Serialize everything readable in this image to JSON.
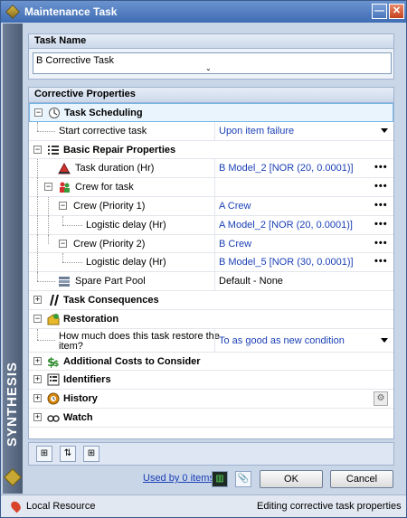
{
  "window": {
    "title": "Maintenance Task",
    "minimize_glyph": "—",
    "close_glyph": "✕"
  },
  "brand": "SYNTHESIS",
  "task_name": {
    "header": "Task Name",
    "value": "B Corrective Task"
  },
  "properties": {
    "header": "Corrective Properties",
    "rows": {
      "task_scheduling": "Task Scheduling",
      "start_corrective_task": {
        "label": "Start corrective task",
        "value": "Upon item failure"
      },
      "basic_repair_properties": "Basic Repair Properties",
      "task_duration": {
        "label": "Task duration (Hr)",
        "value": "B Model_2 [NOR (20, 0.0001)]"
      },
      "crew_for_task": "Crew for task",
      "crew_priority_1": {
        "label": "Crew (Priority 1)",
        "value": "A Crew"
      },
      "logistic_delay_1": {
        "label": "Logistic delay (Hr)",
        "value": "A Model_2 [NOR (20, 0.0001)]"
      },
      "crew_priority_2": {
        "label": "Crew (Priority 2)",
        "value": "B Crew"
      },
      "logistic_delay_2": {
        "label": "Logistic delay (Hr)",
        "value": "B Model_5 [NOR (30, 0.0001)]"
      },
      "spare_part_pool": {
        "label": "Spare Part Pool",
        "value": "Default - None"
      },
      "task_consequences": "Task Consequences",
      "restoration": "Restoration",
      "restore_question": {
        "label_line1": "How much does this task restore the",
        "label_line2": "item?",
        "value": "To as good as new condition"
      },
      "additional_costs": "Additional Costs to Consider",
      "identifiers": "Identifiers",
      "history": "History",
      "watch": "Watch"
    },
    "ellipsis": "•••",
    "expand_minus": "−",
    "expand_plus": "+"
  },
  "actions": {
    "used_by": "Used by 0 items",
    "ok": "OK",
    "cancel": "Cancel"
  },
  "status": {
    "resource": "Local Resource",
    "message": "Editing corrective task properties"
  },
  "icons": [
    "scheduling-icon",
    "repair-properties-icon",
    "duration-icon",
    "crew-icon",
    "spare-part-icon",
    "consequences-icon",
    "restoration-icon",
    "costs-icon",
    "identifiers-icon",
    "history-icon",
    "watch-icon"
  ],
  "colors": {
    "link": "#1a3fb5",
    "titlebar": "#3f6db3",
    "selection": "#76b6e6"
  }
}
